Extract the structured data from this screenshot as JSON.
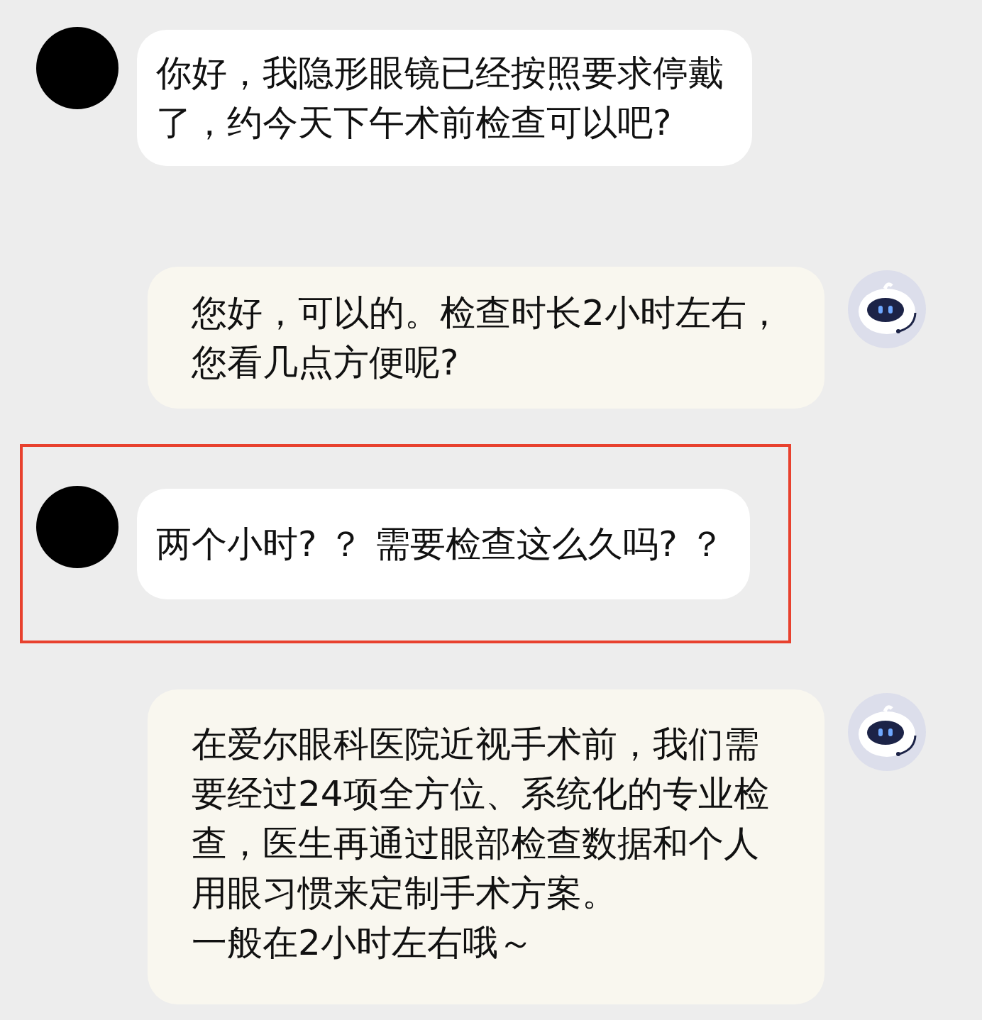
{
  "messages": [
    {
      "kind": "user",
      "highlighted": false,
      "paragraphs": [
        "你好，我隐形眼镜已经按照要求停戴了，约今天下午术前检查可以吧?"
      ]
    },
    {
      "kind": "bot",
      "highlighted": false,
      "paragraphs": [
        "您好，可以的。检查时长2小时左右，您看几点方便呢?"
      ]
    },
    {
      "kind": "user",
      "highlighted": true,
      "paragraphs": [
        "两个小时? ？ 需要检查这么久吗? ？"
      ]
    },
    {
      "kind": "bot",
      "highlighted": false,
      "paragraphs": [
        "在爱尔眼科医院近视手术前，我们需要经过24项全方位、系统化的专业检查，医生再通过眼部检查数据和个人用眼习惯来定制手术方案。",
        "一般在2小时左右哦～"
      ]
    }
  ]
}
